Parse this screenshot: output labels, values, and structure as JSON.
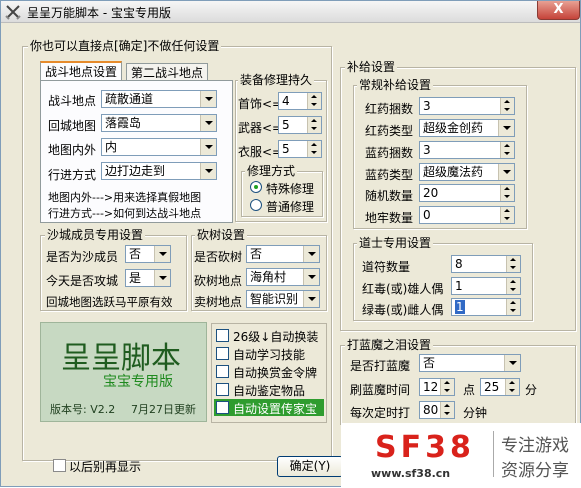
{
  "window": {
    "title": "呈呈万能脚本 - 宝宝专用版",
    "close_label": "X"
  },
  "main_group": {
    "legend": "你也可以直接点[确定]不做任何设置"
  },
  "tabs": [
    {
      "label": "战斗地点设置"
    },
    {
      "label": "第二战斗地点"
    }
  ],
  "battle": {
    "rows": [
      {
        "label": "战斗地点",
        "value": "疏散通道"
      },
      {
        "label": "回城地图",
        "value": "落霞岛"
      },
      {
        "label": "地图内外",
        "value": "内"
      },
      {
        "label": "行进方式",
        "value": "边打边走到"
      }
    ],
    "hint1": "地图内外--->用来选择真假地图",
    "hint2": "行进方式--->如何到达战斗地点"
  },
  "repair": {
    "legend": "装备修理持久",
    "rows": [
      {
        "label": "首饰<=",
        "value": "4"
      },
      {
        "label": "武器<=",
        "value": "5"
      },
      {
        "label": "衣服<=",
        "value": "5"
      }
    ],
    "mode_legend": "修理方式",
    "mode_special": "特殊修理",
    "mode_normal": "普通修理"
  },
  "sabak": {
    "legend": "沙城成员专用设置",
    "rows": [
      {
        "label": "是否为沙成员",
        "value": "否"
      },
      {
        "label": "今天是否攻城",
        "value": "是"
      }
    ],
    "note": "回城地图选跃马平原有效"
  },
  "woodcut": {
    "legend": "砍树设置",
    "rows": [
      {
        "label": "是否砍树",
        "value": "否"
      },
      {
        "label": "砍树地点",
        "value": "海角村"
      },
      {
        "label": "卖树地点",
        "value": "智能识别"
      }
    ]
  },
  "logo": {
    "title": "呈呈脚本",
    "subtitle": "宝宝专用版",
    "version": "版本号: V2.2",
    "updated": "7月27日更新"
  },
  "options": [
    {
      "label": "26级↓自动换装"
    },
    {
      "label": "自动学习技能"
    },
    {
      "label": "自动换赏金令牌"
    },
    {
      "label": "自动鉴定物品"
    },
    {
      "label": "自动设置传家宝"
    }
  ],
  "supply": {
    "legend": "补给设置",
    "regular_legend": "常规补给设置",
    "rows": [
      {
        "label": "红药捆数",
        "value": "3"
      },
      {
        "label": "红药类型",
        "value": "超级金创药"
      },
      {
        "label": "蓝药捆数",
        "value": "3"
      },
      {
        "label": "蓝药类型",
        "value": "超级魔法药"
      },
      {
        "label": "随机数量",
        "value": "20"
      },
      {
        "label": "地牢数量",
        "value": "0"
      }
    ],
    "taoist_legend": "道士专用设置",
    "taoist_rows": [
      {
        "label": "道符数量",
        "value": "8"
      },
      {
        "label": "红毒(或)雄人偶",
        "value": "1"
      },
      {
        "label": "绿毒(或)雌人偶",
        "value": "1"
      }
    ]
  },
  "bluedemon": {
    "legend": "打蓝魔之泪设置",
    "whether_label": "是否打蓝魔",
    "whether_value": "否",
    "time_label": "刷蓝魔时间",
    "hour": "12",
    "hour_unit": "点",
    "minute": "25",
    "minute_unit": "分",
    "interval_label": "每次定时打",
    "interval": "80",
    "interval_unit": "分钟"
  },
  "footer": {
    "no_show_label": "以后别再显示",
    "ok_label": "确定(Y)"
  },
  "watermark": {
    "brand": "SF38",
    "slogan1": "专注游戏",
    "slogan2": "资源分享",
    "url": "www.sf38.cn"
  },
  "colors": {
    "accent_red": "#d9221b",
    "logo_bg": "#c7d9c2",
    "logo_text": "#1f5c1f"
  }
}
